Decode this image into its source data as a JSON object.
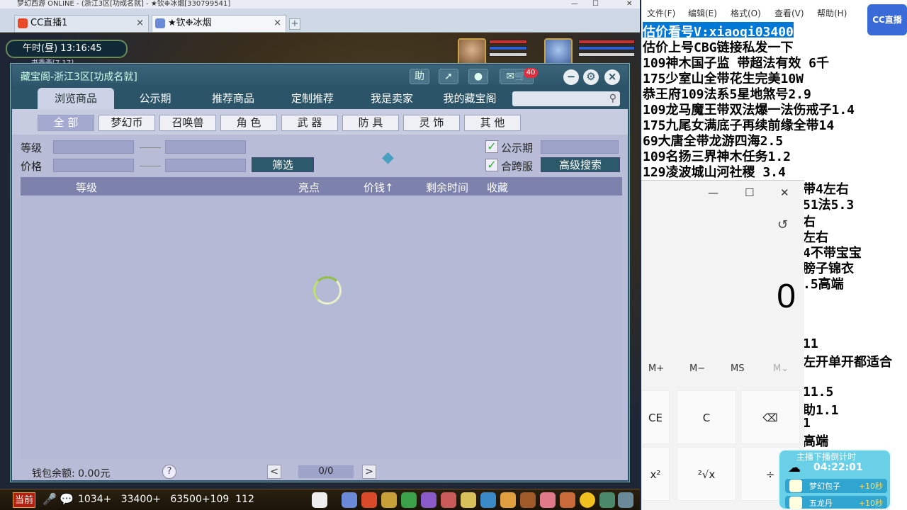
{
  "browser": {
    "title": "梦幻西游 ONLINE - (浙江3区[功成名就] - ★钦❉冰烟[330799541]",
    "tabs": [
      {
        "label": "CC直播1",
        "close": "×"
      },
      {
        "label": "★钦❉冰烟",
        "close": "×"
      }
    ],
    "add_tab": "+",
    "window_controls": [
      "—",
      "☐",
      "✕"
    ]
  },
  "game": {
    "clock": "午时(昼)  13:16:45",
    "location": "书香斋[7,17]"
  },
  "dialog": {
    "title": "藏宝阁-浙江3区[功成名就]",
    "header_buttons": {
      "help": "助",
      "message_count": "40"
    },
    "nav": [
      "浏览商品",
      "公示期",
      "推荐商品",
      "定制推荐",
      "我是卖家",
      "我的藏宝阁"
    ],
    "search_placeholder": "",
    "categories": [
      "全 部",
      "梦幻币",
      "召唤兽",
      "角 色",
      "武 器",
      "防 具",
      "灵 饰",
      "其 他"
    ],
    "filters": {
      "level_label": "等级",
      "price_label": "价格",
      "filter_button": "筛选",
      "public_label": "公示期",
      "cross_server_label": "合跨服",
      "advanced_button": "高级搜索"
    },
    "table_headers": [
      "等级",
      "亮点",
      "价钱↑",
      "剩余时间",
      "收藏"
    ],
    "footer": {
      "wallet": "钱包余额: 0.00元",
      "help": "?",
      "prev": "<",
      "page": "0/0",
      "next": ">"
    }
  },
  "gamebar": {
    "current_button": "当前",
    "coords": "1034+   33400+   63500+109  112"
  },
  "notepad": {
    "menu": [
      "文件(F)",
      "编辑(E)",
      "格式(O)",
      "查看(V)",
      "帮助(H)"
    ],
    "lines": [
      "估价看号V:xiaoqi03400",
      "估价上号CBG链接私发一下",
      "109神木国子监 带超法有效 6千",
      "175少室山全带花生完美10W",
      "恭王府109法系5星地煞号2.9",
      "109龙马魔王带双法爆一法伤戒子1.4",
      "175九尾女满底子再续前缘全带14",
      "69大唐全带龙游四海2.5",
      "109名扬三界神木任务1.2",
      "129凌波城山河社稷    3.4"
    ],
    "right_fragments": [
      "带4左右",
      "51法5.3",
      "右",
      "左右",
      "4不带宝宝",
      "膀子锦衣",
      ".5高端",
      "11",
      "左开单开都适合",
      "11.5",
      "助1.1",
      "1",
      "高端"
    ],
    "cc_logo": "CC直播"
  },
  "calculator": {
    "controls": [
      "—",
      "☐",
      "✕"
    ],
    "display": "0",
    "memory": [
      "M+",
      "M−",
      "MS",
      "M⌄"
    ],
    "keys_row1": [
      "CE",
      "C",
      "⌫"
    ],
    "keys_row2": [
      "x²",
      "²√x",
      "÷"
    ]
  },
  "timer": {
    "title": "主播下播倒计时",
    "time": "04:22:01",
    "rows": [
      {
        "label": "梦幻包子",
        "value": "+10秒"
      },
      {
        "label": "五龙丹",
        "value": "+10秒"
      }
    ]
  }
}
